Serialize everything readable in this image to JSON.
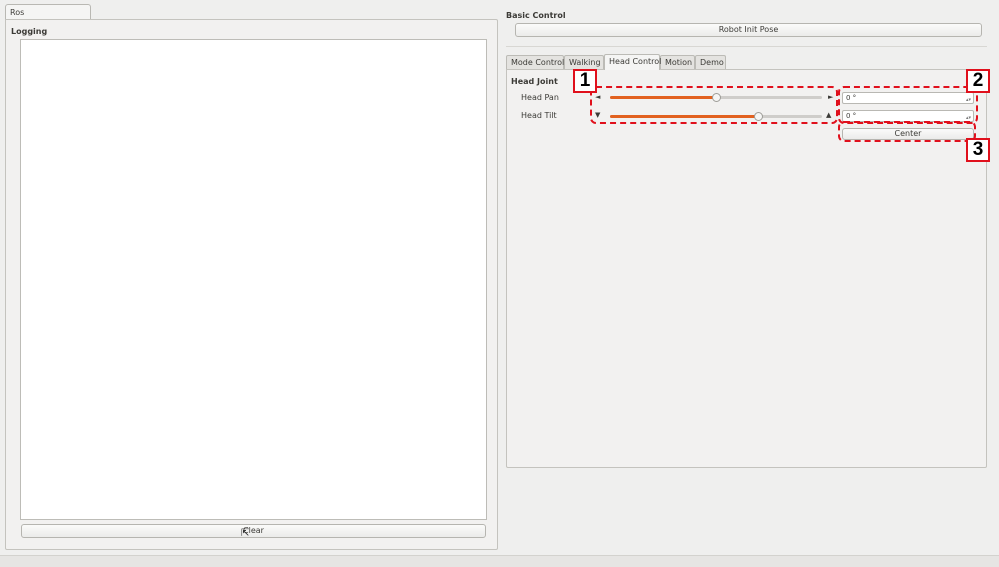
{
  "left_tab": {
    "label": "Ros Communications"
  },
  "logging": {
    "label": "Logging",
    "clear_label": "Clear"
  },
  "basic_control": {
    "label": "Basic Control",
    "init_pose_label": "Robot Init Pose"
  },
  "tabs": [
    {
      "label": "Mode Control"
    },
    {
      "label": "Walking"
    },
    {
      "label": "Head Control",
      "active": true
    },
    {
      "label": "Motion"
    },
    {
      "label": "Demo"
    }
  ],
  "head_joint": {
    "label": "Head Joint",
    "pan": {
      "label": "Head Pan",
      "value": "0 °",
      "slider_fraction": 0.5,
      "arrow_left": "◄",
      "arrow_right": "►"
    },
    "tilt": {
      "label": "Head Tilt",
      "value": "0 °",
      "slider_fraction": 0.7,
      "arrow_left": "▼",
      "arrow_right": "▲"
    },
    "center_label": "Center"
  },
  "annotations": {
    "one": "1",
    "two": "2",
    "three": "3"
  },
  "colors": {
    "slider_fill": "#e2611f",
    "annotation": "#e0101c"
  }
}
